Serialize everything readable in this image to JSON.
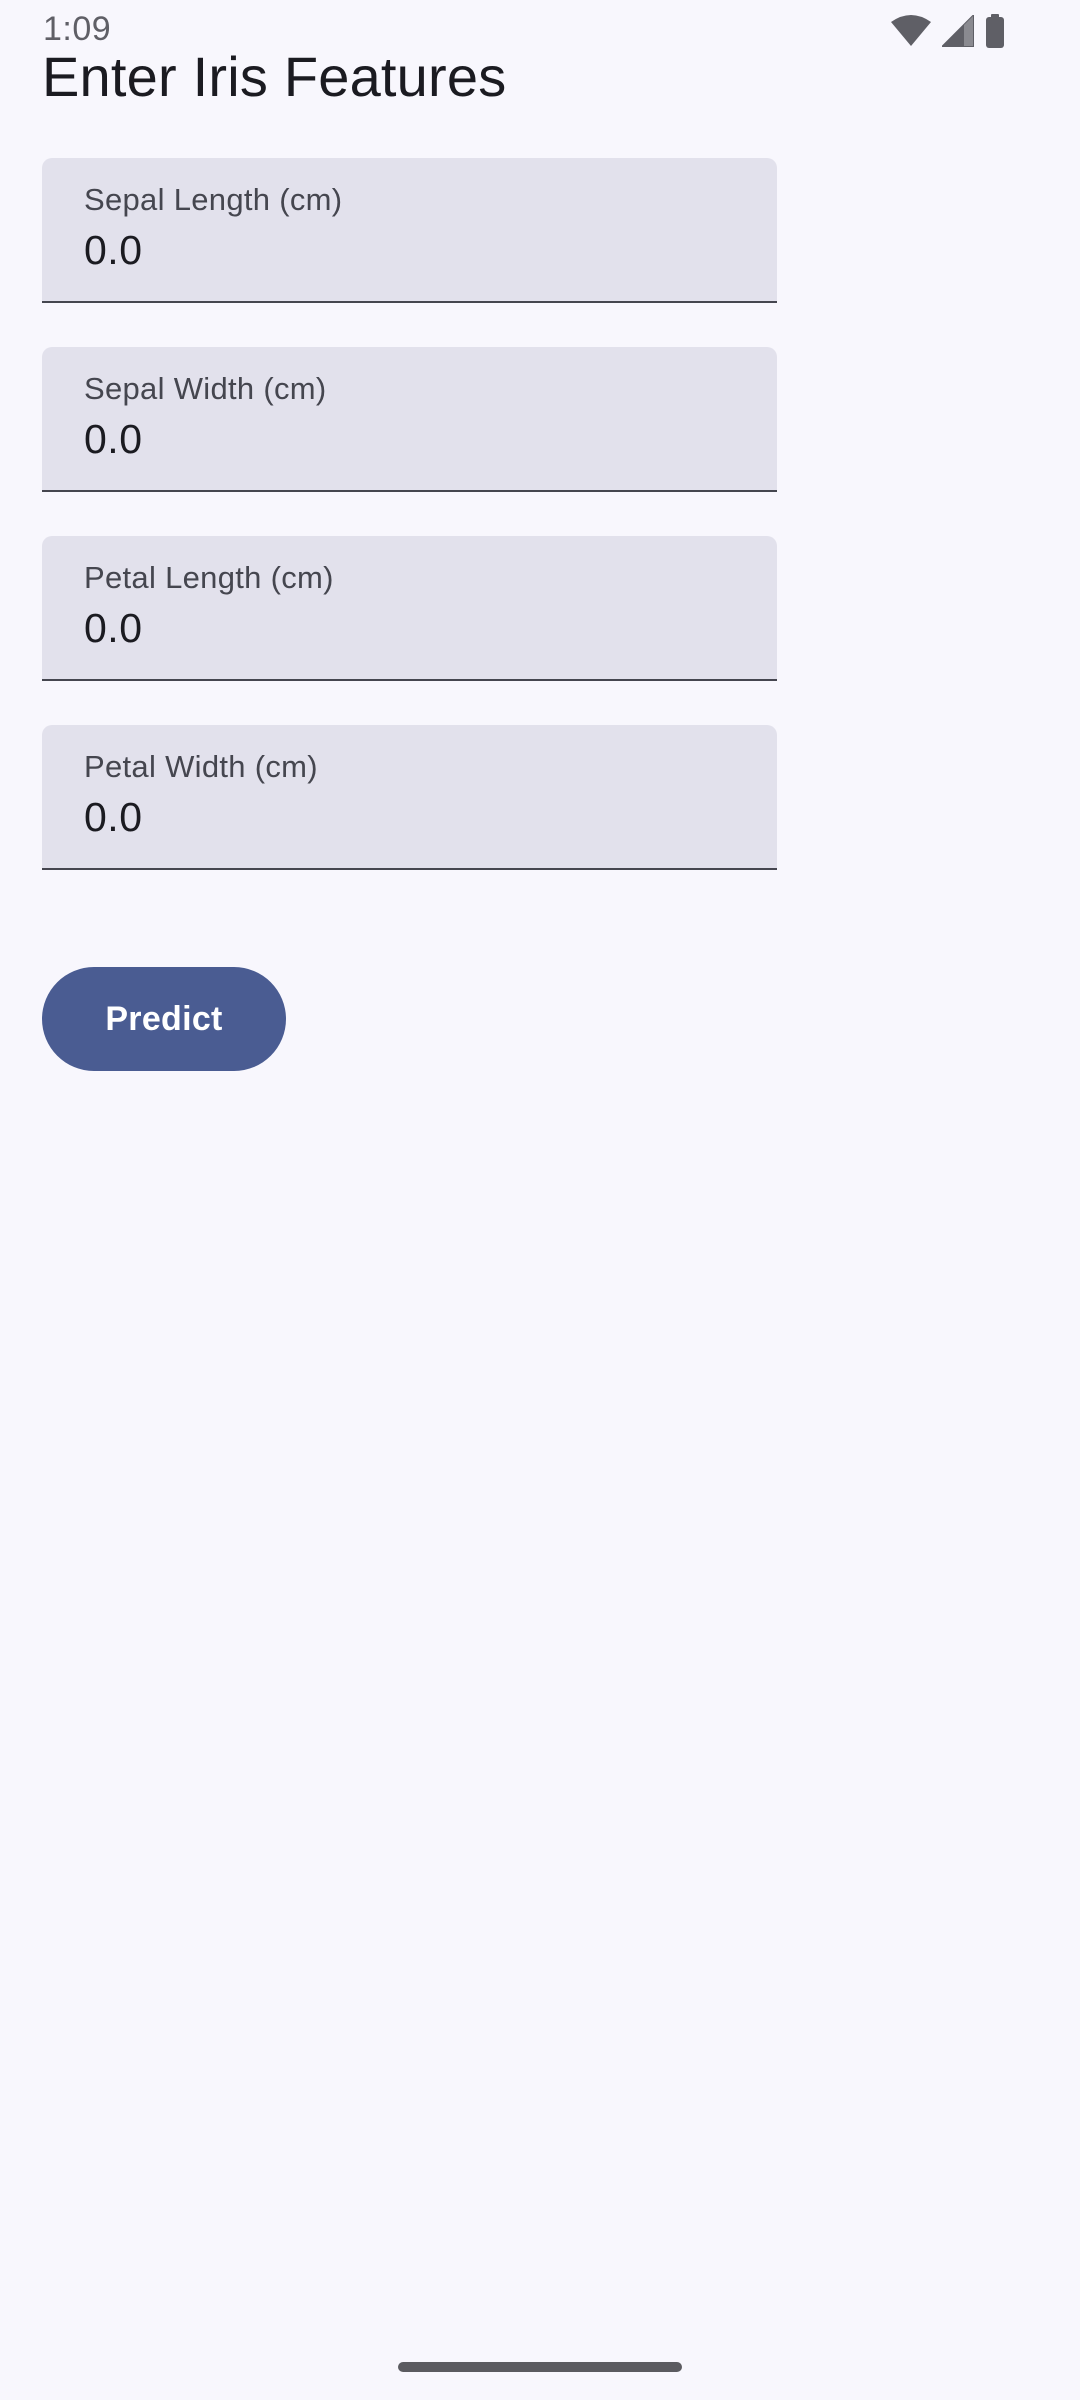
{
  "status_bar": {
    "time": "1:09",
    "icons": [
      "wifi-icon",
      "cellular-signal-icon",
      "battery-icon"
    ]
  },
  "page": {
    "title": "Enter Iris Features"
  },
  "fields": [
    {
      "label": "Sepal Length (cm)",
      "value": "0.0"
    },
    {
      "label": "Sepal Width (cm)",
      "value": "0.0"
    },
    {
      "label": "Petal Length (cm)",
      "value": "0.0"
    },
    {
      "label": "Petal Width (cm)",
      "value": "0.0"
    }
  ],
  "actions": {
    "predict_label": "Predict"
  },
  "colors": {
    "background": "#f8f7fd",
    "field_fill": "#e2e1ec",
    "field_indicator": "#45464f",
    "primary": "#4a5c92",
    "on_primary": "#ffffff"
  }
}
